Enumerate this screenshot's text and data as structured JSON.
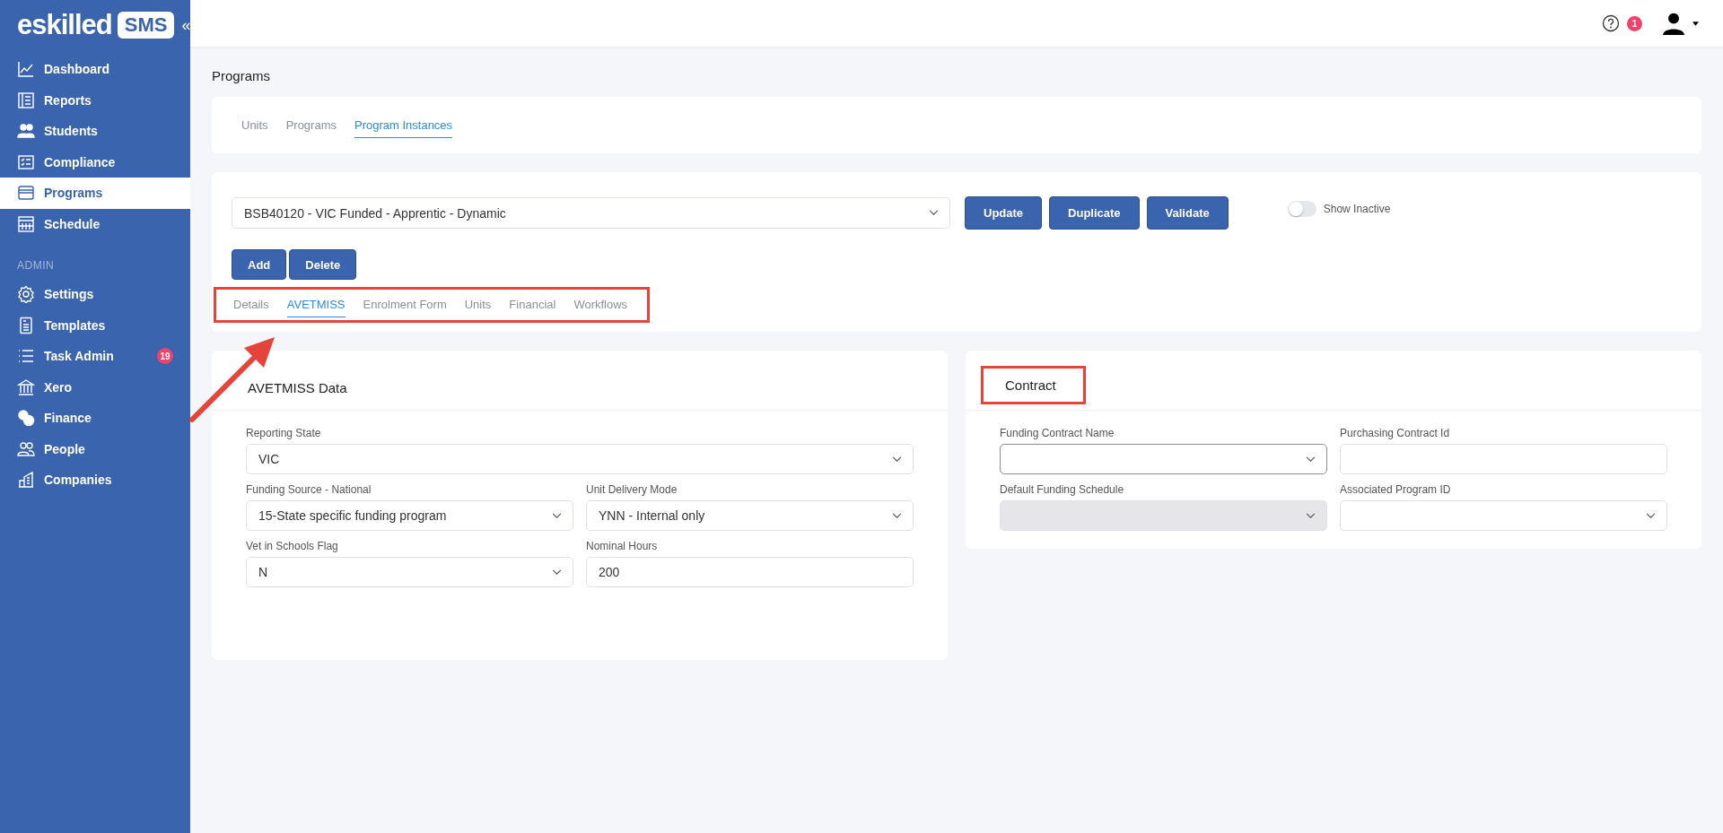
{
  "sidebar": {
    "logo": "eskilled",
    "logo_badge": "SMS",
    "collapse": "«",
    "sections": [
      {
        "items": [
          {
            "label": "Dashboard",
            "selected": false
          },
          {
            "label": "Reports",
            "selected": false
          },
          {
            "label": "Students",
            "selected": false
          },
          {
            "label": "Compliance",
            "selected": false
          },
          {
            "label": "Programs",
            "selected": true
          },
          {
            "label": "Schedule",
            "selected": false
          }
        ]
      },
      {
        "heading": "ADMIN",
        "items": [
          {
            "label": "Settings",
            "selected": false
          },
          {
            "label": "Templates",
            "selected": false
          },
          {
            "label": "Task Admin",
            "selected": false,
            "badge": "19"
          },
          {
            "label": "Xero",
            "selected": false
          },
          {
            "label": "Finance",
            "selected": false
          },
          {
            "label": "People",
            "selected": false
          },
          {
            "label": "Companies",
            "selected": false
          }
        ]
      }
    ]
  },
  "header": {
    "notification_count": "1"
  },
  "page_title": "Programs",
  "top_tabs": [
    {
      "label": "Units",
      "selected": false
    },
    {
      "label": "Programs",
      "selected": false
    },
    {
      "label": "Program Instances",
      "selected": true
    }
  ],
  "program_select": {
    "value": "BSB40120 - VIC Funded - Apprentic - Dynamic"
  },
  "actions": [
    "Update",
    "Duplicate",
    "Validate"
  ],
  "show_inactive": {
    "label": "Show Inactive",
    "on": false
  },
  "edit_actions": [
    "Add",
    "Delete"
  ],
  "detail_tabs": [
    {
      "label": "Details",
      "selected": false
    },
    {
      "label": "AVETMISS",
      "selected": true
    },
    {
      "label": "Enrolment Form",
      "selected": false
    },
    {
      "label": "Units",
      "selected": false
    },
    {
      "label": "Financial",
      "selected": false
    },
    {
      "label": "Workflows",
      "selected": false
    }
  ],
  "cards": [
    {
      "title": "AVETMISS Data",
      "highlighted": false,
      "rows": [
        [
          {
            "label": "Reporting State",
            "kind": "select",
            "value": "VIC",
            "disabled": false,
            "focused": false
          }
        ],
        [
          {
            "label": "Funding Source - National",
            "kind": "select",
            "value": "15-State specific funding program",
            "disabled": false,
            "focused": false
          },
          {
            "label": "Unit Delivery Mode",
            "kind": "select",
            "value": "YNN - Internal only",
            "disabled": false,
            "focused": false
          }
        ],
        [
          {
            "label": "Vet in Schools Flag",
            "kind": "select",
            "value": "N",
            "disabled": false,
            "focused": false
          },
          {
            "label": "Nominal Hours",
            "kind": "text",
            "value": "200",
            "disabled": false,
            "focused": false
          }
        ]
      ]
    },
    {
      "title": "Contract",
      "highlighted": true,
      "rows": [
        [
          {
            "label": "Funding Contract Name",
            "kind": "select",
            "disabled": false,
            "focused": true
          },
          {
            "label": "Purchasing Contract Id",
            "kind": "text",
            "disabled": false,
            "focused": false
          }
        ],
        [
          {
            "label": "Default Funding Schedule",
            "kind": "select",
            "disabled": true,
            "focused": false
          },
          {
            "label": "Associated Program ID",
            "kind": "select",
            "disabled": false,
            "focused": false
          }
        ]
      ]
    }
  ]
}
